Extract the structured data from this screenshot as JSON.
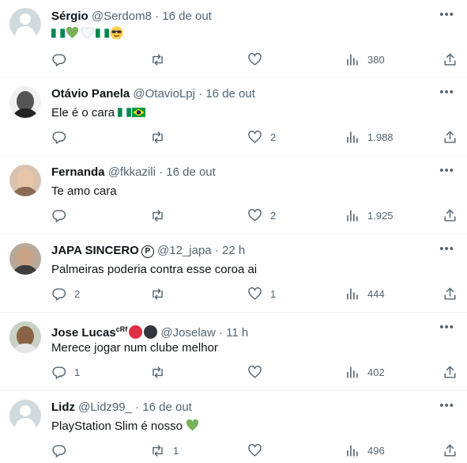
{
  "tweets": [
    {
      "name": "Sérgio",
      "handle": "@Serdom8",
      "time": "16 de out",
      "text": "",
      "replies": "",
      "retweets": "",
      "likes": "",
      "views": "380"
    },
    {
      "name": "Otávio Panela",
      "handle": "@OtavioLpj",
      "time": "16 de out",
      "text": "Ele é o cara",
      "replies": "",
      "retweets": "",
      "likes": "2",
      "views": "1.988"
    },
    {
      "name": "Fernanda",
      "handle": "@fkkazili",
      "time": "16 de out",
      "text": "Te amo cara",
      "replies": "",
      "retweets": "",
      "likes": "2",
      "views": "1.925"
    },
    {
      "name": "JAPA SINCERO",
      "handle": "@12_japa",
      "time": "22 h",
      "text": "Palmeiras poderia contra esse coroa ai",
      "replies": "2",
      "retweets": "",
      "likes": "1",
      "views": "444"
    },
    {
      "name": "Jose Lucas",
      "name_suffix": "cRf",
      "handle": "@Joselaw",
      "time": "11 h",
      "text": "Merece jogar num clube melhor",
      "replies": "1",
      "retweets": "",
      "likes": "",
      "views": "402"
    },
    {
      "name": "Lidz",
      "handle": "@Lidz99_",
      "time": "16 de out",
      "text": "PlayStation Slim é nosso",
      "replies": "",
      "retweets": "1",
      "likes": "",
      "views": "496"
    }
  ],
  "separator": "·",
  "verified_badge_letter": "P",
  "icons": {
    "reply": "reply-icon",
    "retweet": "retweet-icon",
    "like": "heart-icon",
    "views": "views-icon",
    "share": "share-icon",
    "more": "more-icon"
  },
  "colors": {
    "text": "#0f1419",
    "muted": "#536471",
    "divider": "#eff3f4",
    "default_avatar": "#cfd9de",
    "heart_green": "#78b159",
    "nigeria_green": "#008751",
    "brazil_green": "#009c3b",
    "brazil_yellow": "#ffdf00",
    "brazil_blue": "#002776",
    "red_circle": "#dd2e44",
    "black_circle": "#31373d"
  }
}
